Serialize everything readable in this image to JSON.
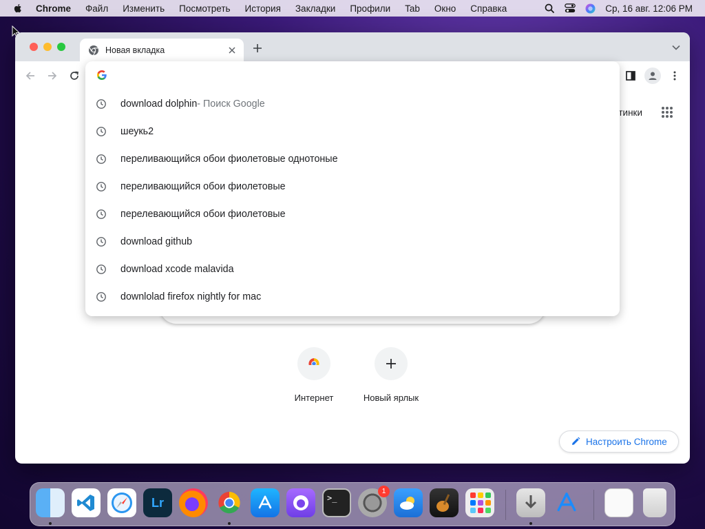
{
  "menubar": {
    "apple_icon": "apple-logo-icon",
    "items": [
      "Chrome",
      "Файл",
      "Изменить",
      "Посмотреть",
      "История",
      "Закладки",
      "Профили",
      "Tab",
      "Окно",
      "Справка"
    ],
    "clock": "Ср, 16 авг.  12:06 PM"
  },
  "browser": {
    "tab_title": "Новая вкладка",
    "ntp_images_link": "тинки",
    "shortcuts": [
      {
        "label": "Интернет",
        "icon": "chrome-icon"
      },
      {
        "label": "Новый ярлык",
        "icon": "plus-icon"
      }
    ],
    "customize_label": "Настроить Chrome"
  },
  "omnibox": {
    "suggestions": [
      {
        "text": "download dolphin",
        "suffix": " - Поиск Google"
      },
      {
        "text": "шеукь2",
        "suffix": ""
      },
      {
        "text": "переливающийся обои фиолетовые однотоные",
        "suffix": ""
      },
      {
        "text": "переливающийся обои фиолетовые",
        "suffix": ""
      },
      {
        "text": "перелевающийся обои фиолетовые",
        "suffix": ""
      },
      {
        "text": "download github",
        "suffix": ""
      },
      {
        "text": "download xcode malavida",
        "suffix": ""
      },
      {
        "text": "downlolad firefox nightly for mac",
        "suffix": ""
      }
    ]
  },
  "dock": {
    "apps": [
      "finder-icon",
      "vscode-icon",
      "safari-icon",
      "lightroom-icon",
      "firefox-icon",
      "chrome-icon",
      "app-store-icon",
      "github-desktop-icon",
      "terminal-icon",
      "system-settings-icon",
      "weather-icon",
      "garageband-icon",
      "launchpad-icon",
      "downloads-icon",
      "app-store-installer-icon",
      "preview-icon",
      "trash-icon"
    ],
    "lightroom_label": "Lr",
    "settings_badge": "1"
  }
}
